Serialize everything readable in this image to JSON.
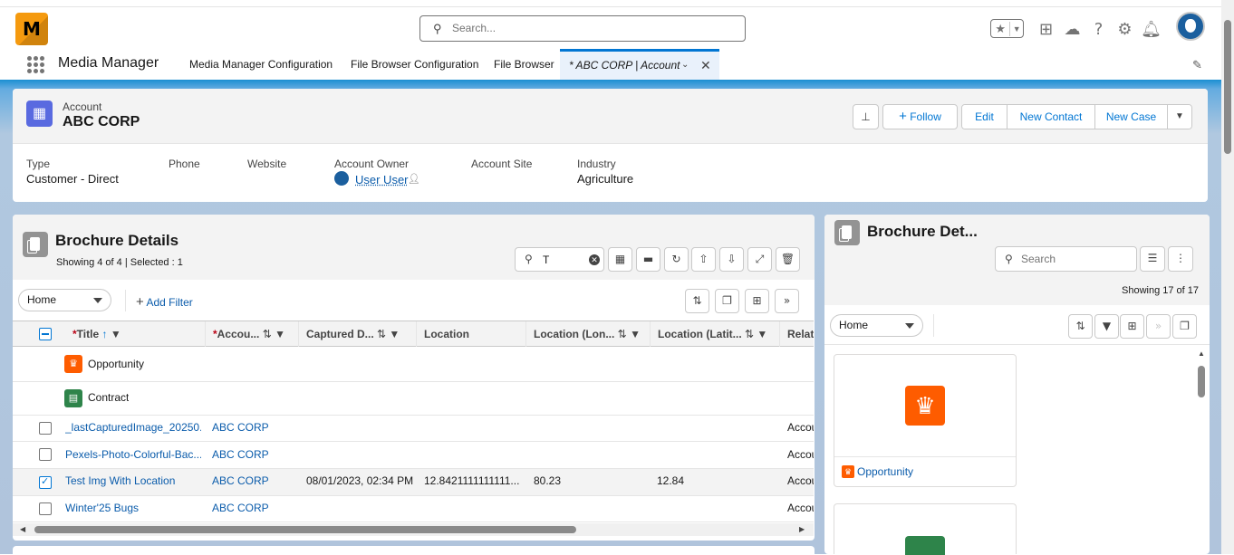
{
  "header": {
    "logo_text": "M",
    "search_placeholder": "Search...",
    "app_name": "Media Manager"
  },
  "nav": {
    "tabs": [
      "Media Manager Configuration",
      "File Browser Configuration",
      "File Browser"
    ],
    "active_tab": "* ABC CORP | Account"
  },
  "record": {
    "object_label": "Account",
    "name": "ABC CORP",
    "buttons": {
      "follow": "Follow",
      "edit": "Edit",
      "new_contact": "New Contact",
      "new_case": "New Case"
    },
    "fields": [
      {
        "label": "Type",
        "value": "Customer - Direct"
      },
      {
        "label": "Phone",
        "value": ""
      },
      {
        "label": "Website",
        "value": ""
      },
      {
        "label": "Account Owner",
        "value": "User User"
      },
      {
        "label": "Account Site",
        "value": ""
      },
      {
        "label": "Industry",
        "value": "Agriculture"
      }
    ]
  },
  "left_panel": {
    "title": "Brochure Details",
    "subtitle": "Showing 4 of 4 | Selected : 1",
    "search_value": "T",
    "folder_select": "Home",
    "add_filter": "Add Filter",
    "columns": [
      "Title",
      "Accou...",
      "Captured D...",
      "Location",
      "Location (Lon...",
      "Location (Latit...",
      "Relat"
    ],
    "folders": [
      {
        "name": "Opportunity",
        "color": "#fe5c00"
      },
      {
        "name": "Contract",
        "color": "#2e844a"
      }
    ],
    "rows": [
      {
        "title": "_lastCapturedImage_20250...",
        "account": "ABC CORP",
        "captured": "",
        "location": "",
        "lon": "",
        "lat": "",
        "related": "Accou",
        "checked": false
      },
      {
        "title": "Pexels-Photo-Colorful-Bac...",
        "account": "ABC CORP",
        "captured": "",
        "location": "",
        "lon": "",
        "lat": "",
        "related": "Accou",
        "checked": false
      },
      {
        "title": "Test Img With Location",
        "account": "ABC CORP",
        "captured": "08/01/2023, 02:34 PM",
        "location": "12.8421111111111...",
        "lon": "80.23",
        "lat": "12.84",
        "related": "Accou",
        "checked": true
      },
      {
        "title": "Winter'25 Bugs",
        "account": "ABC CORP",
        "captured": "",
        "location": "",
        "lon": "",
        "lat": "",
        "related": "Accou",
        "checked": false
      }
    ]
  },
  "right_panel": {
    "title": "Brochure Det...",
    "search_placeholder": "Search",
    "count": "Showing 17 of 17",
    "folder_select": "Home",
    "tiles": [
      {
        "label": "Opportunity",
        "color": "#fe5c00"
      }
    ]
  }
}
